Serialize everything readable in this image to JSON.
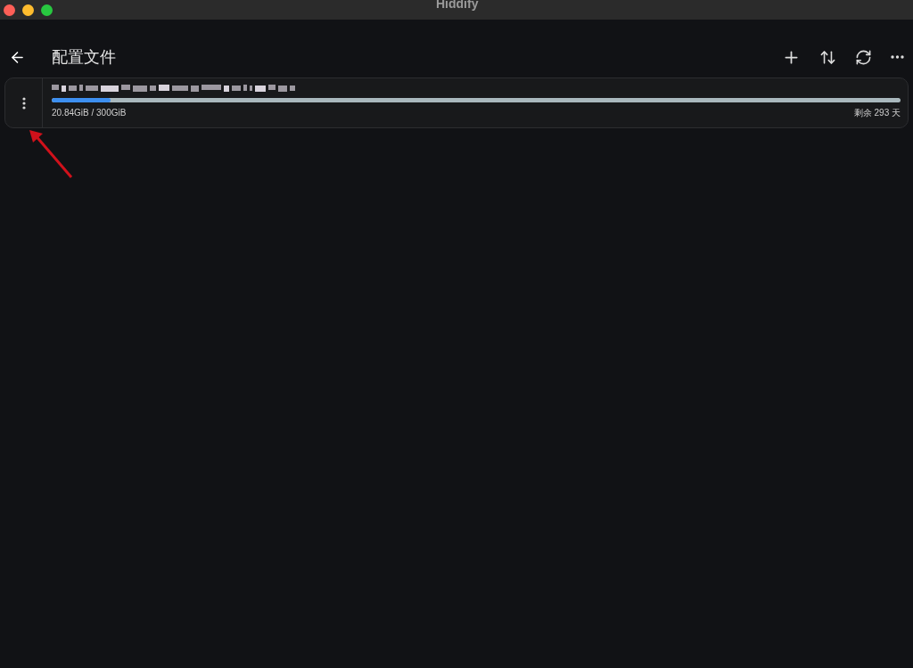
{
  "window": {
    "title": "Hiddify"
  },
  "header": {
    "title": "配置文件"
  },
  "profiles": [
    {
      "usage": "20.84GiB / 300GiB",
      "level": 0.0695,
      "remaining": "剩余 293 天"
    }
  ]
}
